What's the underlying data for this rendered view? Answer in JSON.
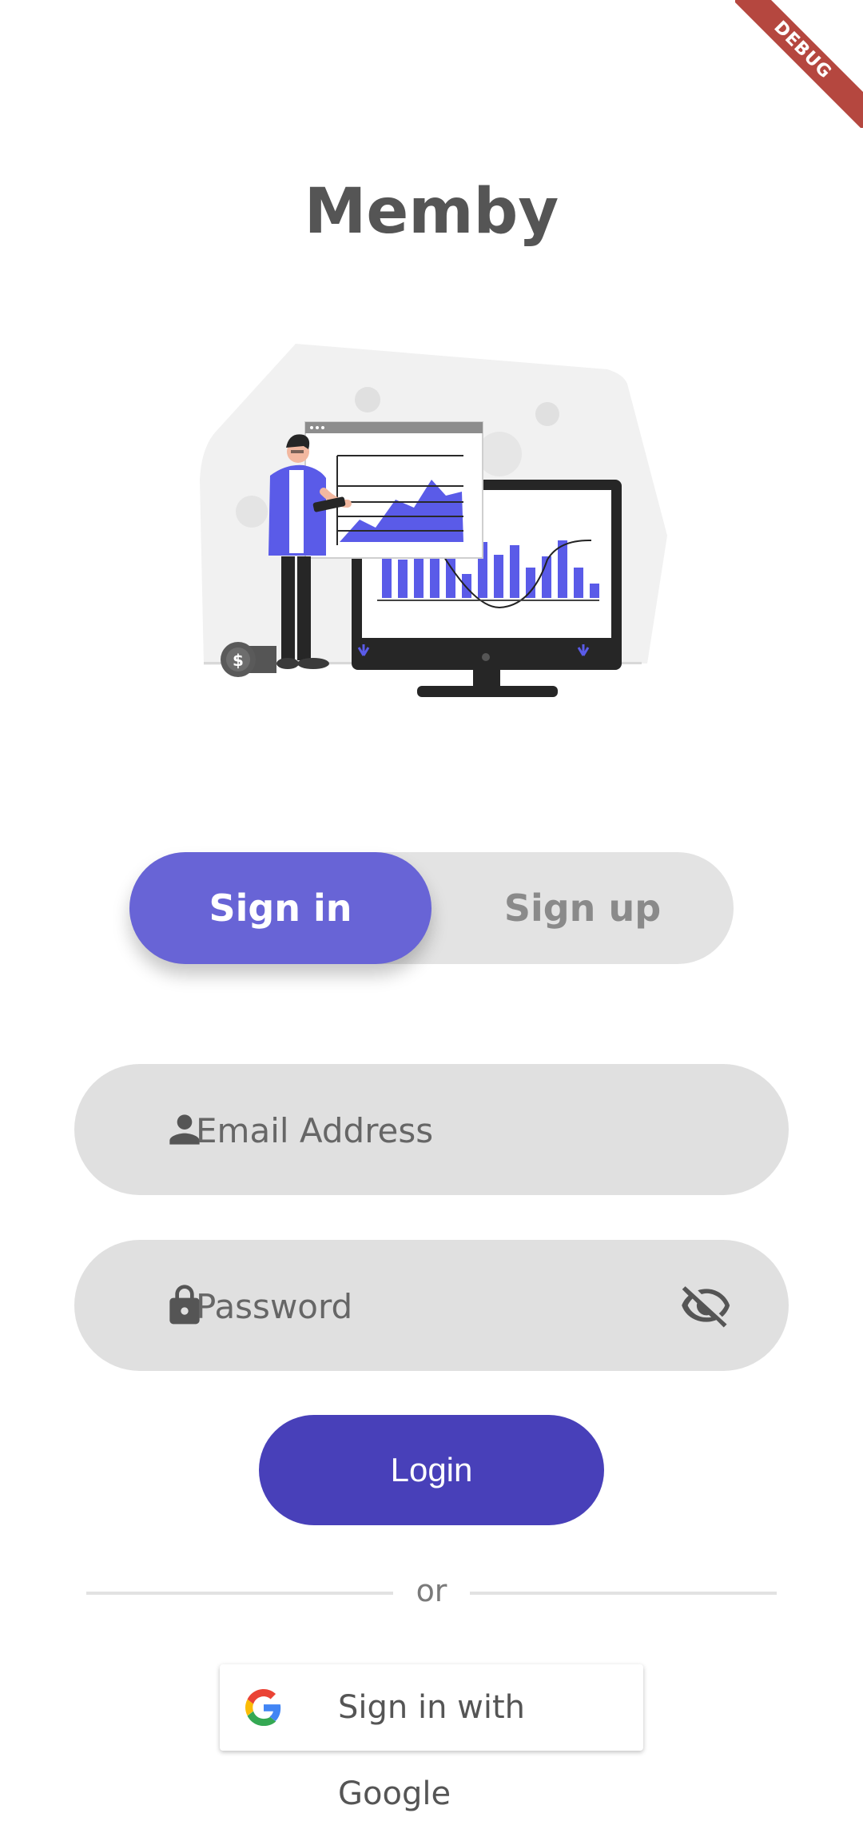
{
  "app": {
    "title": "Memby",
    "debug_banner": "DEBUG"
  },
  "auth_toggle": {
    "active_label": "Sign in",
    "inactive_label": "Sign up"
  },
  "form": {
    "email": {
      "placeholder": "Email Address",
      "icon": "person-icon"
    },
    "password": {
      "placeholder": "Password",
      "icon": "lock-icon",
      "visibility_icon": "eye-off-icon"
    },
    "login_label": "Login",
    "divider_text": "or",
    "google_label": "Sign in with Google"
  },
  "colors": {
    "accent": "#6864d6",
    "login": "#4840b9",
    "field_bg": "#e0e0e0",
    "title": "#555555"
  }
}
